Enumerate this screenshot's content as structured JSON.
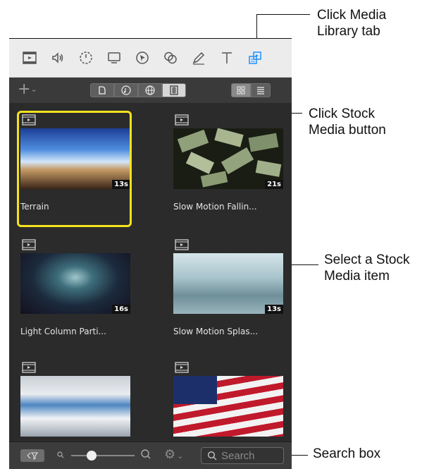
{
  "callouts": {
    "media_library_tab": "Click Media\nLibrary tab",
    "stock_media_button": "Click Stock\nMedia button",
    "select_item": "Select a Stock\nMedia item",
    "search_box": "Search box"
  },
  "toolbar": {
    "add_label": "+",
    "tools": [
      "film-icon",
      "audio-icon",
      "timer-icon",
      "monitor-icon",
      "cursor-icon",
      "blend-icon",
      "pen-icon",
      "text-icon",
      "media-library-icon"
    ]
  },
  "media_tabs": [
    "stock-audio-icon",
    "music-icon",
    "globe-icon",
    "stock-media-icon"
  ],
  "items": [
    {
      "name": "Terrain",
      "duration": "13s"
    },
    {
      "name": "Slow Motion Fallin...",
      "duration": "21s"
    },
    {
      "name": "Light Column Parti...",
      "duration": "16s"
    },
    {
      "name": "Slow Motion Splas...",
      "duration": "13s"
    },
    {
      "name": "",
      "duration": ""
    },
    {
      "name": "",
      "duration": ""
    }
  ],
  "search": {
    "placeholder": "Search"
  },
  "colors": {
    "accent": "#1e90ff",
    "selection": "#f4e21e",
    "panel": "#2b2b2b"
  }
}
